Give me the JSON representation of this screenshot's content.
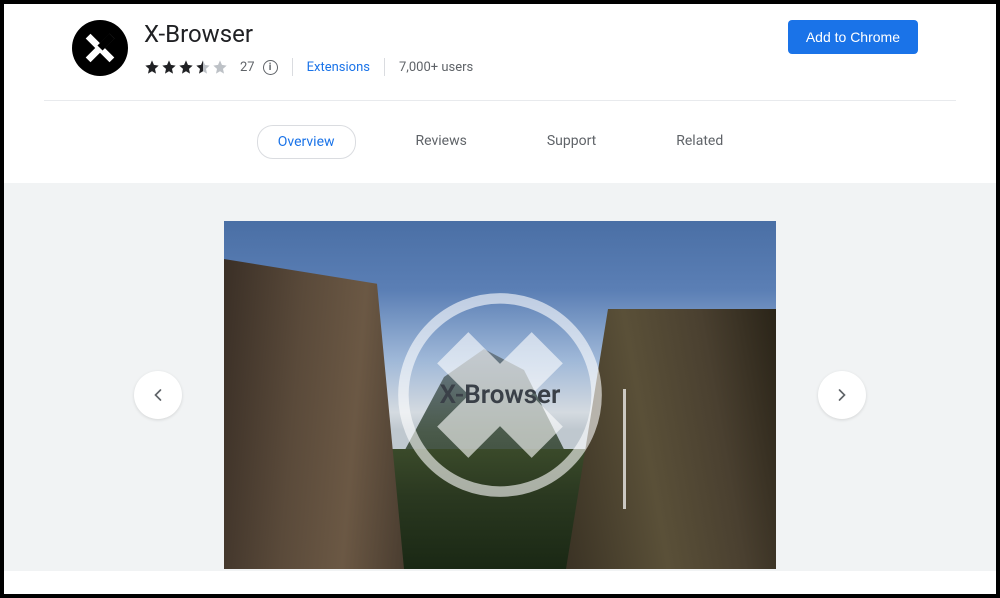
{
  "header": {
    "title": "X-Browser",
    "rating_count": "27",
    "category_link": "Extensions",
    "users_text": "7,000+ users",
    "add_button": "Add to Chrome",
    "stars_filled": 3.5
  },
  "tabs": {
    "items": [
      {
        "label": "Overview",
        "active": true
      },
      {
        "label": "Reviews",
        "active": false
      },
      {
        "label": "Support",
        "active": false
      },
      {
        "label": "Related",
        "active": false
      }
    ]
  },
  "gallery": {
    "overlay_text": "X-Browser"
  },
  "colors": {
    "primary": "#1a73e8",
    "text": "#202124",
    "muted": "#5f6368"
  }
}
